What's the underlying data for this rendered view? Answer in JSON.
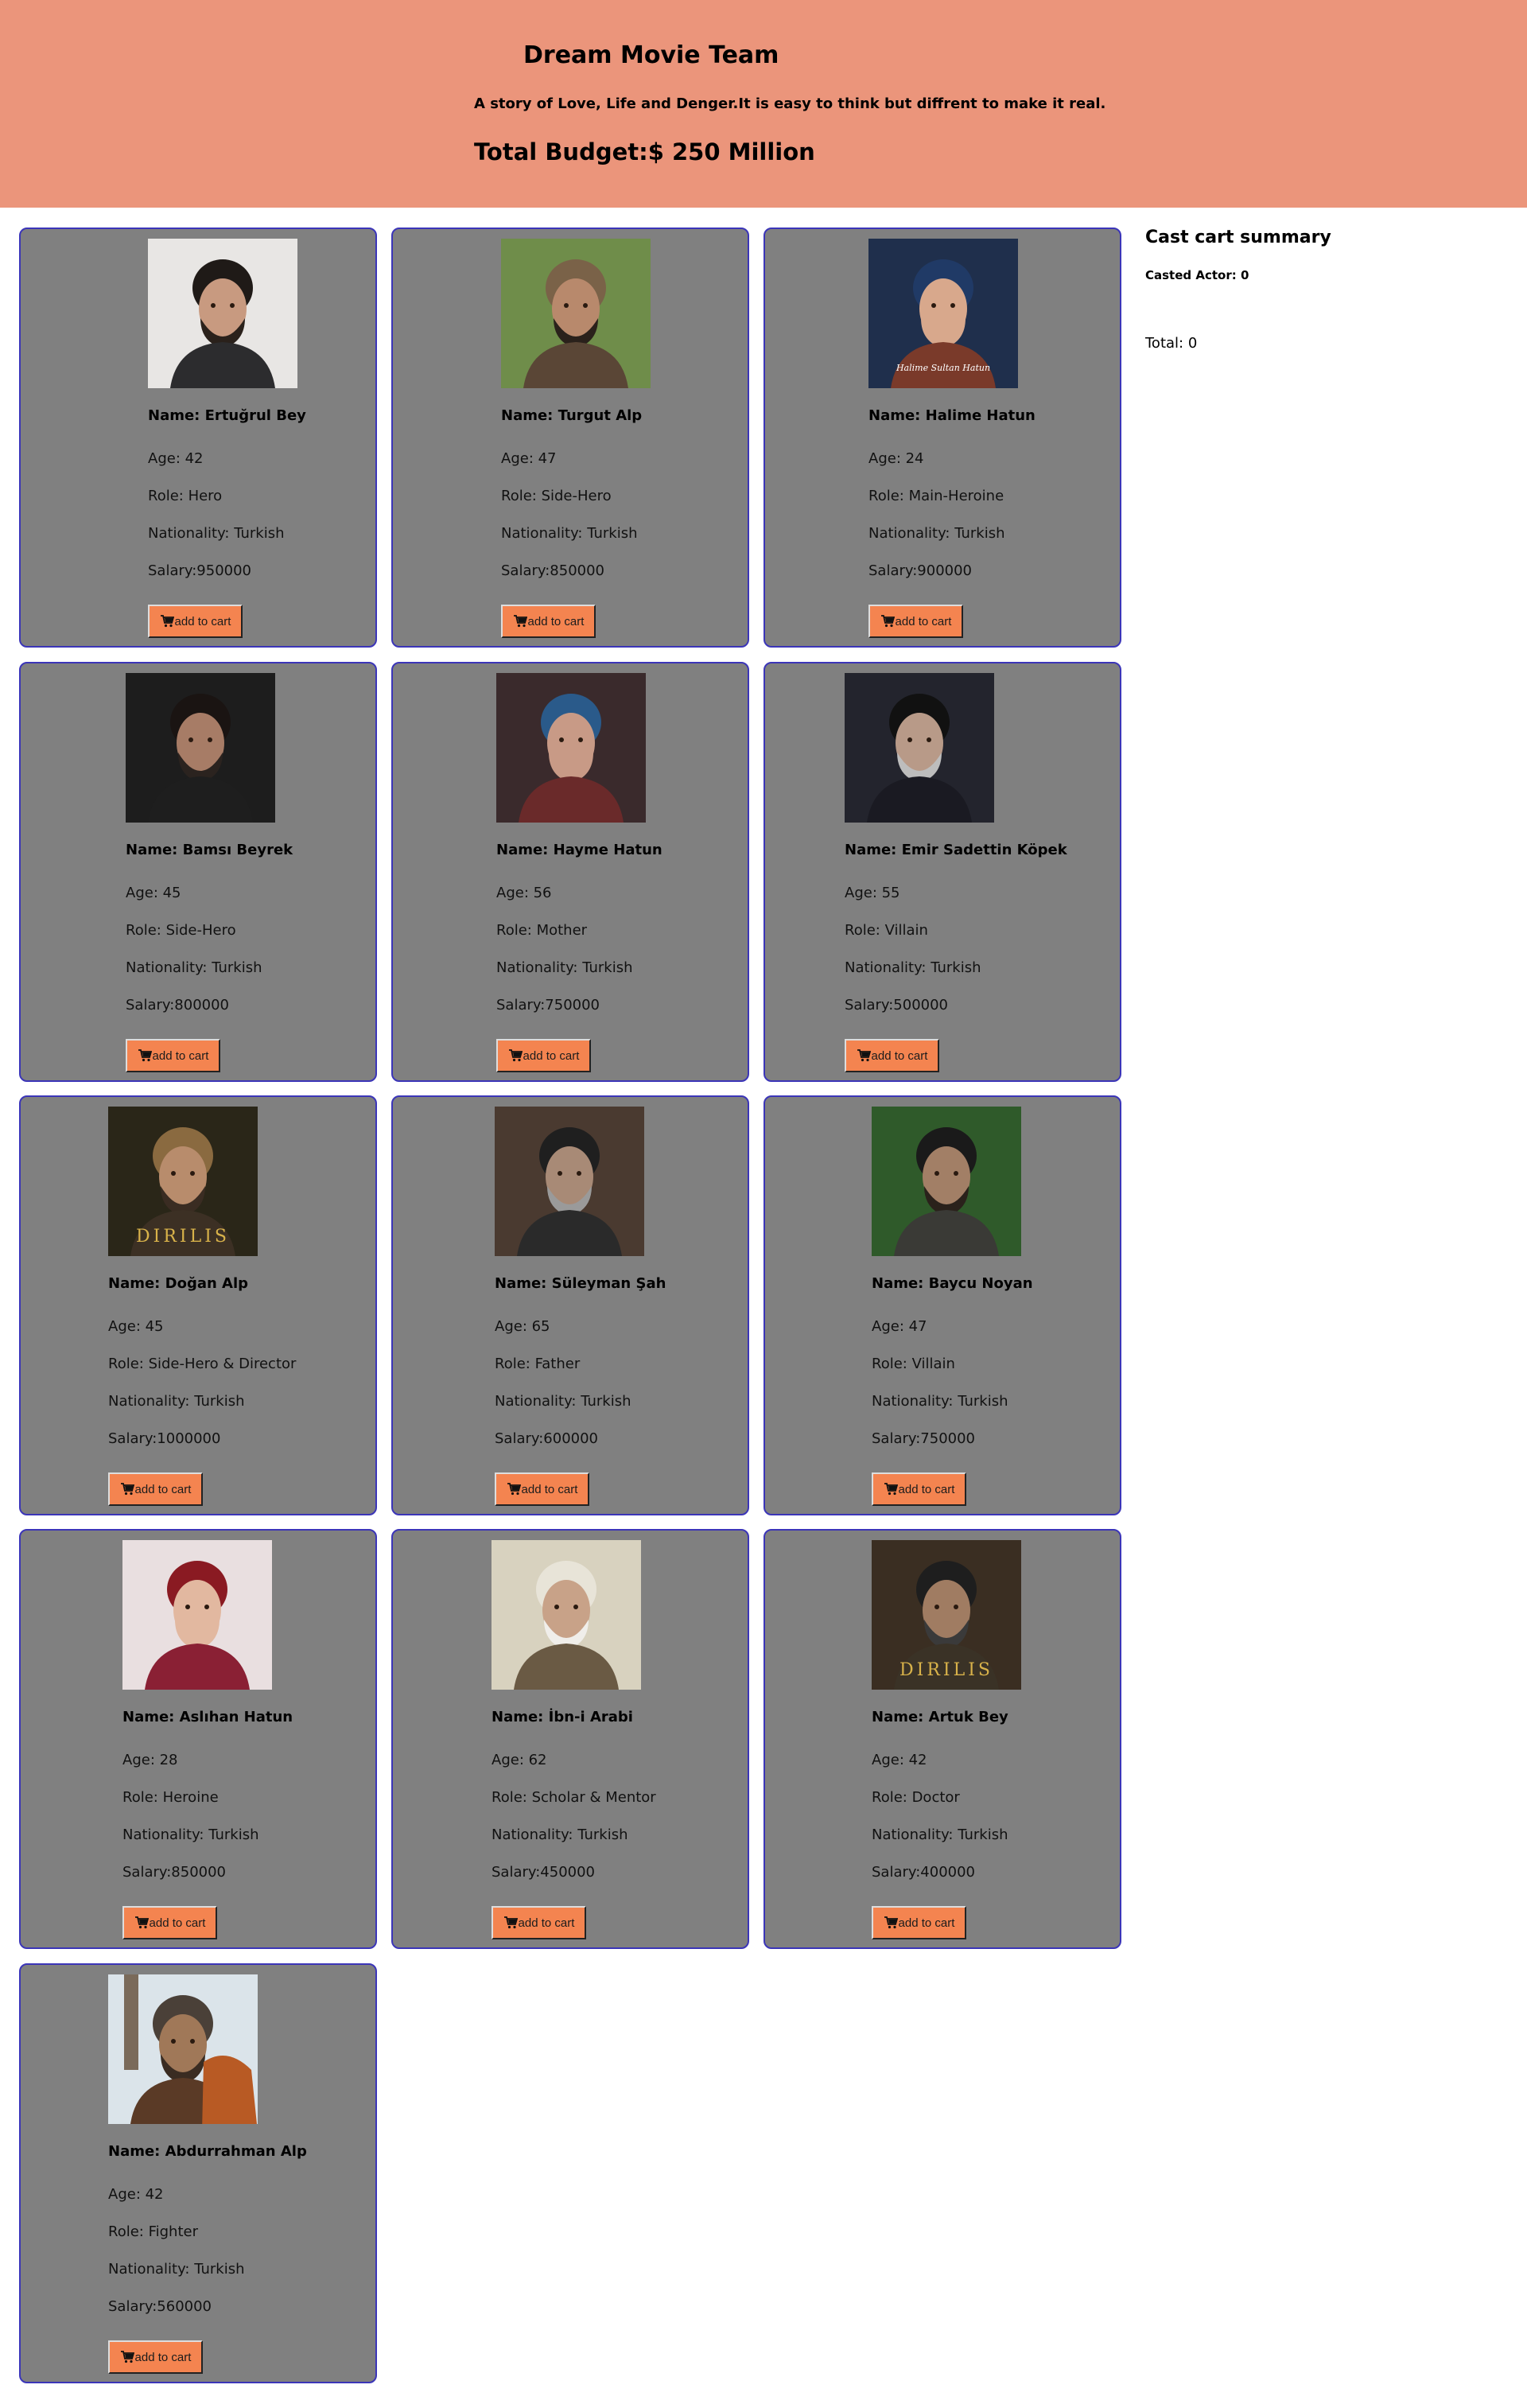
{
  "header": {
    "title": "Dream Movie Team",
    "story": "A story of Love, Life and Denger.It is easy to think but diffrent to make it real.",
    "budget": "Total Budget:$ 250 Million",
    "background": "#eb957b"
  },
  "card_style": {
    "background": "#808080",
    "border": "#3b35b8",
    "button": "#f48450"
  },
  "cast": [
    {
      "name": "Name: Ertuğrul Bey",
      "age": "Age: 42",
      "role": "Role: Hero",
      "nationality": "Nationality: Turkish",
      "salary": "Salary:950000",
      "button": "add to cart",
      "photo": "man-clasped-hands-dark-sweater-photo"
    },
    {
      "name": "Name: Turgut Alp",
      "age": "Age: 47",
      "role": "Role: Side-Hero",
      "nationality": "Nationality: Turkish",
      "salary": "Salary:850000",
      "button": "add to cart",
      "photo": "man-fur-hat-forest-photo"
    },
    {
      "name": "Name: Halime Hatun",
      "age": "Age: 24",
      "role": "Role: Main-Heroine",
      "nationality": "Nationality: Turkish",
      "salary": "Salary:900000",
      "button": "add to cart",
      "photo": "woman-headscarf-blue-photo",
      "caption": "Halime Sultan Hatun"
    },
    {
      "name": "Name: Bamsı Beyrek",
      "age": "Age: 45",
      "role": "Role: Side-Hero",
      "nationality": "Nationality: Turkish",
      "salary": "Salary:800000",
      "button": "add to cart",
      "photo": "bearded-man-long-hair-photo"
    },
    {
      "name": "Name: Hayme Hatun",
      "age": "Age: 56",
      "role": "Role: Mother",
      "nationality": "Nationality: Turkish",
      "salary": "Salary:750000",
      "button": "add to cart",
      "photo": "older-woman-headdress-photo"
    },
    {
      "name": "Name: Emir Sadettin Köpek",
      "age": "Age: 55",
      "role": "Role: Villain",
      "nationality": "Nationality: Turkish",
      "salary": "Salary:500000",
      "button": "add to cart",
      "photo": "man-black-turban-grey-beard-photo"
    },
    {
      "name": "Name: Doğan Alp",
      "age": "Age: 45",
      "role": "Role: Side-Hero & Director",
      "nationality": "Nationality: Turkish",
      "salary": "Salary:1000000",
      "button": "add to cart",
      "photo": "man-fur-hat-diriliş-poster-photo",
      "caption": "DIRILIS"
    },
    {
      "name": "Name: Süleyman Şah",
      "age": "Age: 65",
      "role": "Role: Father",
      "nationality": "Nationality: Turkish",
      "salary": "Salary:600000",
      "button": "add to cart",
      "photo": "seated-elder-armor-photo"
    },
    {
      "name": "Name: Baycu Noyan",
      "age": "Age: 47",
      "role": "Role: Villain",
      "nationality": "Nationality: Turkish",
      "salary": "Salary:750000",
      "button": "add to cart",
      "photo": "warrior-topknot-green-photo"
    },
    {
      "name": "Name: Aslıhan Hatun",
      "age": "Age: 28",
      "role": "Role: Heroine",
      "nationality": "Nationality: Turkish",
      "salary": "Salary:850000",
      "button": "add to cart",
      "photo": "woman-red-headdress-photo"
    },
    {
      "name": "Name: İbn-i Arabi",
      "age": "Age: 62",
      "role": "Role: Scholar & Mentor",
      "nationality": "Nationality: Turkish",
      "salary": "Salary:450000",
      "button": "add to cart",
      "photo": "elder-white-turban-photo"
    },
    {
      "name": "Name: Artuk Bey",
      "age": "Age: 42",
      "role": "Role: Doctor",
      "nationality": "Nationality: Turkish",
      "salary": "Salary:400000",
      "button": "add to cart",
      "photo": "man-dark-turban-diriliş-poster-photo",
      "caption": "DIRILIS"
    },
    {
      "name": "Name: Abdurrahman Alp",
      "age": "Age: 42",
      "role": "Role: Fighter",
      "nationality": "Nationality: Turkish",
      "salary": "Salary:560000",
      "button": "add to cart",
      "photo": "warrior-with-horse-photo"
    }
  ],
  "summary": {
    "title": "Cast cart summary",
    "casted_actor": "Casted Actor: 0",
    "total": "Total: 0"
  }
}
